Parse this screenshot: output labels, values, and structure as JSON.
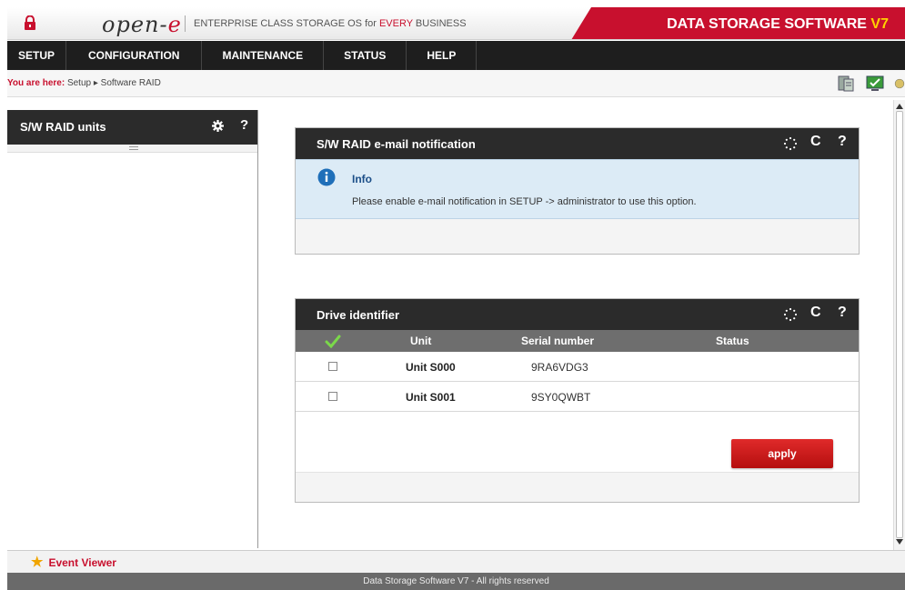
{
  "header": {
    "brand_prefix": "open-",
    "brand_suffix": "e",
    "tagline_pre": "ENTERPRISE CLASS STORAGE OS for ",
    "tagline_em": "EVERY",
    "tagline_post": " BUSINESS",
    "product_main": "DATA STORAGE SOFTWARE ",
    "product_ver": "V7",
    "accent_color": "#c8102e"
  },
  "nav": {
    "items": [
      "SETUP",
      "CONFIGURATION",
      "MAINTENANCE",
      "STATUS",
      "HELP"
    ]
  },
  "breadcrumb": {
    "label": "You are here:",
    "path": " Setup ▸ Software RAID"
  },
  "left_panel": {
    "title": "S/W RAID units",
    "help": "?"
  },
  "email_panel": {
    "title": "S/W RAID e-mail notification",
    "refresh": "C",
    "help": "?",
    "info_title": "Info",
    "info_message": "Please enable e-mail notification in SETUP -> administrator to use this option."
  },
  "drive_panel": {
    "title": "Drive identifier",
    "refresh": "C",
    "help": "?",
    "columns": {
      "unit": "Unit",
      "serial": "Serial number",
      "status": "Status"
    },
    "rows": [
      {
        "unit": "Unit S000",
        "serial": "9RA6VDG3",
        "status": ""
      },
      {
        "unit": "Unit S001",
        "serial": "9SY0QWBT",
        "status": ""
      }
    ],
    "apply_label": "apply"
  },
  "bottom": {
    "event_viewer": "Event Viewer",
    "footer": "Data Storage Software V7 - All rights reserved"
  },
  "icons": [
    "lock-icon",
    "storage-icon",
    "monitor-icon",
    "info-icon",
    "gear-icon",
    "spinner-icon",
    "check-icon",
    "star-icon"
  ]
}
